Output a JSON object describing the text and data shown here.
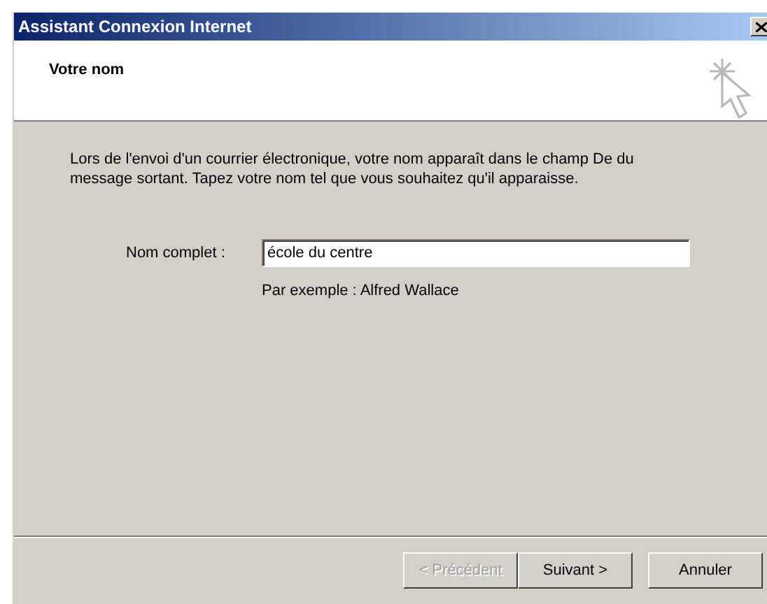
{
  "window": {
    "title": "Assistant Connexion Internet"
  },
  "header": {
    "title": "Votre nom"
  },
  "intro": "Lors de l'envoi d'un courrier électronique, votre nom apparaît dans le champ De du message sortant. Tapez votre nom tel que vous souhaitez qu'il apparaisse.",
  "field": {
    "label": "Nom complet :",
    "value": "école du centre"
  },
  "example": "Par exemple : Alfred Wallace",
  "buttons": [
    {
      "label": "< Précédent",
      "disabled": true
    },
    {
      "label": "Suivant >",
      "disabled": false
    },
    {
      "label": "Annuler",
      "disabled": false
    }
  ]
}
